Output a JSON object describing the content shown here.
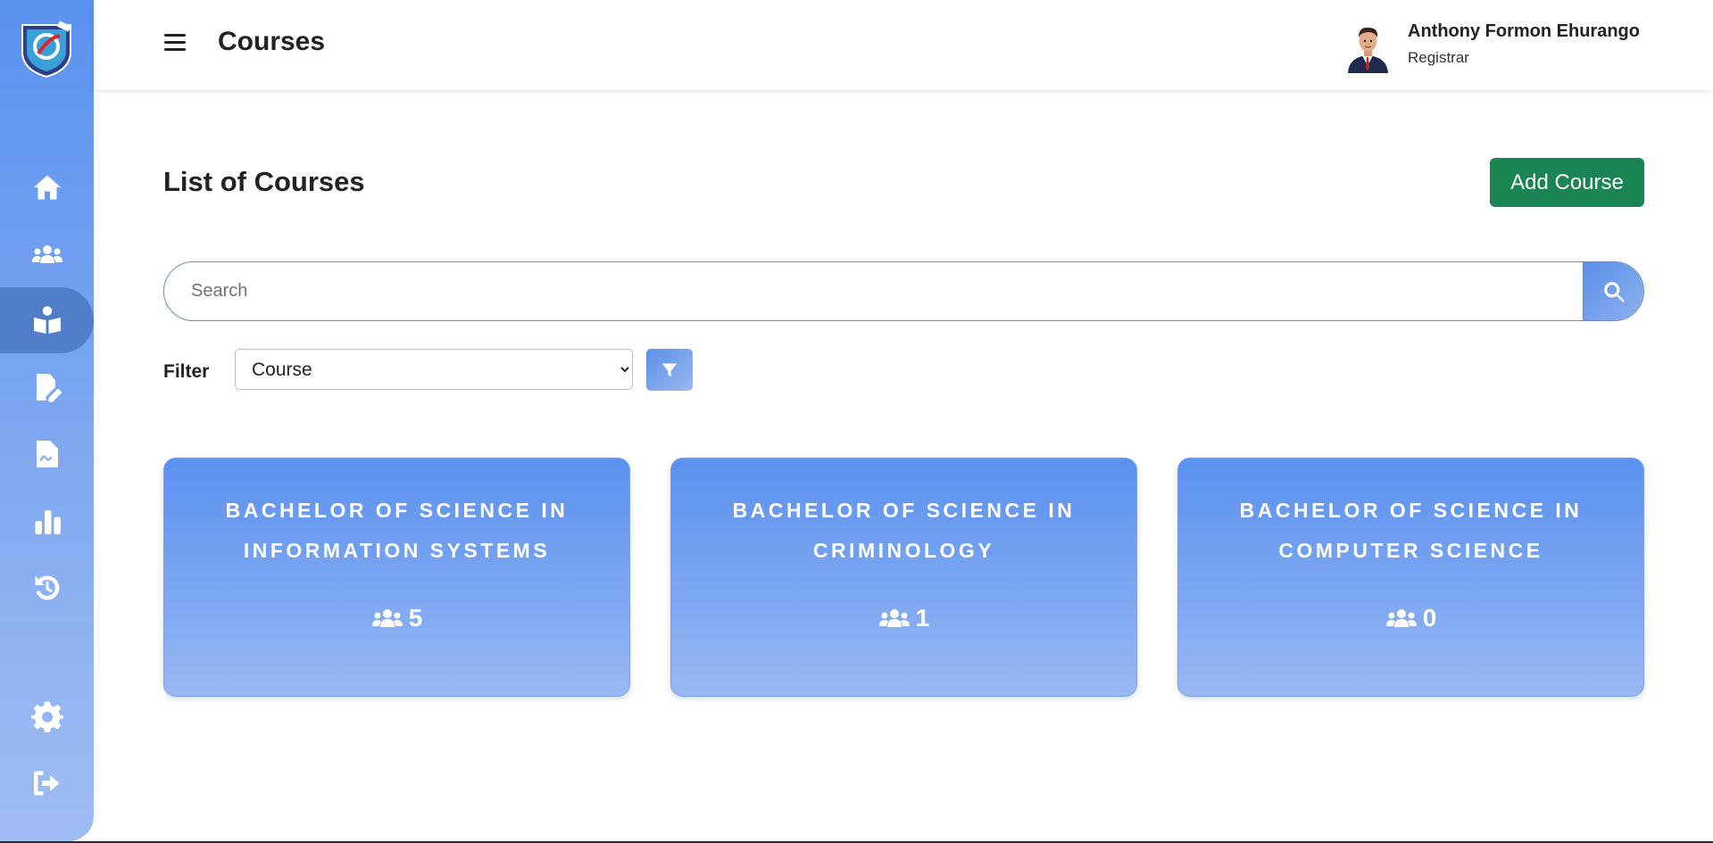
{
  "header": {
    "page_title": "Courses",
    "user": {
      "name": "Anthony Formon Ehurango",
      "role": "Registrar"
    }
  },
  "sidebar": {
    "items": [
      {
        "name": "home",
        "icon": "home-icon"
      },
      {
        "name": "users",
        "icon": "users-icon"
      },
      {
        "name": "courses",
        "icon": "book-reader-icon",
        "active": true
      },
      {
        "name": "edit-file",
        "icon": "file-edit-icon"
      },
      {
        "name": "signature-file",
        "icon": "file-signature-icon"
      },
      {
        "name": "reports",
        "icon": "bar-chart-icon"
      },
      {
        "name": "history",
        "icon": "history-icon"
      },
      {
        "name": "settings",
        "icon": "gear-icon"
      },
      {
        "name": "logout",
        "icon": "logout-icon"
      }
    ]
  },
  "main": {
    "title": "List of Courses",
    "add_button": "Add Course",
    "search": {
      "placeholder": "Search",
      "value": ""
    },
    "filter": {
      "label": "Filter",
      "selected": "Course",
      "options": [
        "Course"
      ]
    },
    "courses": [
      {
        "title": "BACHELOR OF SCIENCE IN INFORMATION SYSTEMS",
        "count": "5"
      },
      {
        "title": "BACHELOR OF SCIENCE IN CRIMINOLOGY",
        "count": "1"
      },
      {
        "title": "BACHELOR OF SCIENCE IN COMPUTER SCIENCE",
        "count": "0"
      }
    ]
  },
  "colors": {
    "sidebar_top": "#5a92ef",
    "sidebar_bottom": "#9fbdf3",
    "add_button": "#1a8553",
    "card_top": "#5b91ef",
    "card_bottom": "#98b8f4"
  }
}
